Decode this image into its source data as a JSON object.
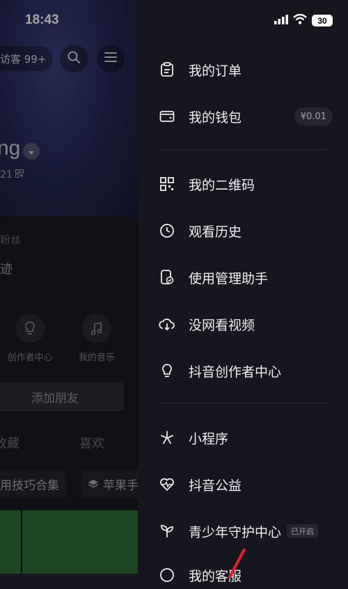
{
  "status_bar": {
    "time": "18:43",
    "battery": "30"
  },
  "profile": {
    "visitors": "访客 99+",
    "username": "ng",
    "uid": "21",
    "fans": "粉丝",
    "fans_sub": "迹",
    "tools": [
      {
        "label": "创作者中心",
        "icon": "lightbulb-icon"
      },
      {
        "label": "我的音乐",
        "icon": "music-note-icon"
      }
    ],
    "add_friends": "添加朋友",
    "tabs": [
      "收藏",
      "喜欢"
    ],
    "chips": [
      "用技巧合集",
      "苹果手"
    ]
  },
  "menu": {
    "items": [
      {
        "label": "我的订单",
        "icon": "order-clipboard-icon"
      },
      {
        "label": "我的钱包",
        "icon": "wallet-icon",
        "badge": "¥0.01"
      },
      {
        "label": "我的二维码",
        "icon": "qr-code-icon"
      },
      {
        "label": "观看历史",
        "icon": "clock-icon"
      },
      {
        "label": "使用管理助手",
        "icon": "phone-timer-icon"
      },
      {
        "label": "没网看视频",
        "icon": "cloud-download-icon"
      },
      {
        "label": "抖音创作者中心",
        "icon": "lightbulb-icon"
      },
      {
        "label": "小程序",
        "icon": "asterisk-icon"
      },
      {
        "label": "抖音公益",
        "icon": "heart-pulse-icon"
      },
      {
        "label": "青少年守护中心",
        "icon": "sprout-icon",
        "badge": "已开启"
      },
      {
        "label": "我的客服",
        "icon": "headset-icon"
      }
    ]
  }
}
